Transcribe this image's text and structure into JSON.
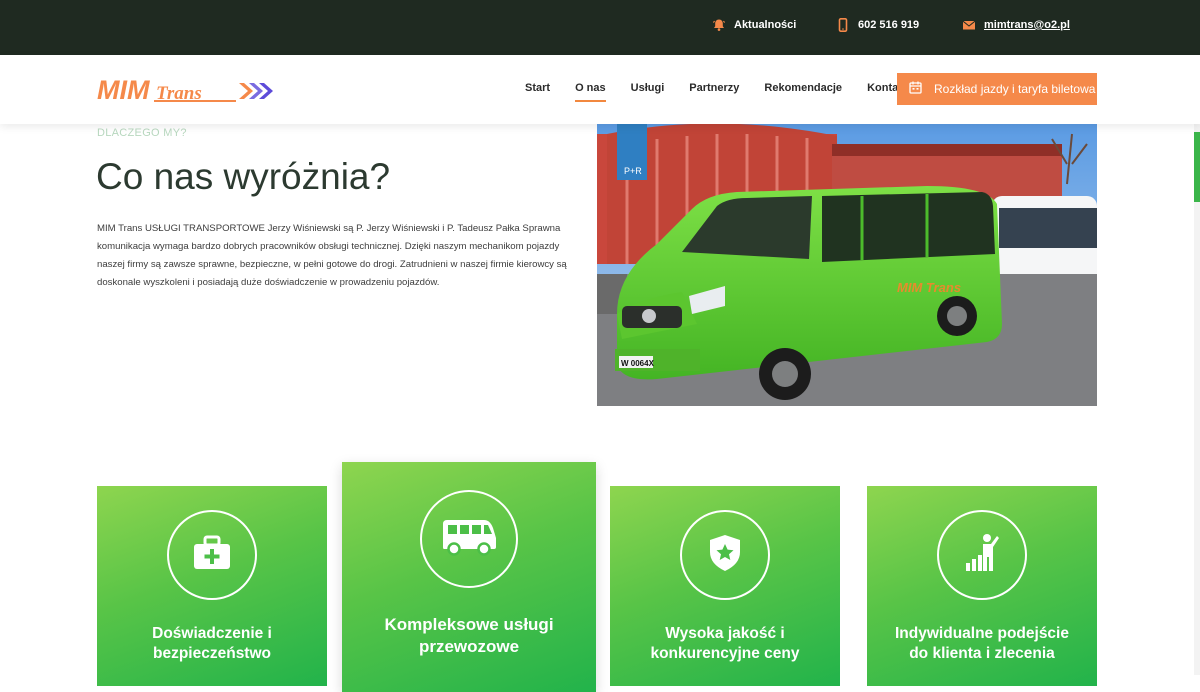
{
  "topbar": {
    "news_label": "Aktualności",
    "phone": "602 516 919",
    "email": "mimtrans@o2.pl"
  },
  "header": {
    "logo_text": "MIM TRANS",
    "nav": [
      {
        "label": "Start",
        "active": false
      },
      {
        "label": "O nas",
        "active": true
      },
      {
        "label": "Usługi",
        "active": false
      },
      {
        "label": "Partnerzy",
        "active": false
      },
      {
        "label": "Rekomendacje",
        "active": false
      },
      {
        "label": "Kontakt",
        "active": false
      }
    ],
    "cta_label": "Rozkład jazdy i taryfa biletowa"
  },
  "main": {
    "eyebrow": "DLACZEGO MY?",
    "title": "Co nas wyróżnia?",
    "paragraph": "MIM Trans USŁUGI TRANSPORTOWE Jerzy Wiśniewski są P. Jerzy Wiśniewski i P. Tadeusz Pałka Sprawna komunikacja wymaga bardzo dobrych pracowników obsługi technicznej. Dzięki naszym mechanikom pojazdy naszej firmy są zawsze sprawne, bezpieczne, w pełni gotowe do drogi. Zatrudnieni w naszej firmie kierowcy są doskonale wyszkoleni i posiadają duże doświadczenie w prowadzeniu pojazdów.",
    "photo_plate": "W 0064X"
  },
  "cards": [
    {
      "line1": "Doświadczenie i",
      "line2": "bezpieczeństwo",
      "icon": "first-aid-kit-icon"
    },
    {
      "line1": "Kompleksowe usługi",
      "line2": "przewozowe",
      "icon": "van-icon"
    },
    {
      "line1": "Wysoka jakość i",
      "line2": "konkurencyjne ceny",
      "icon": "star-shield-icon"
    },
    {
      "line1": "Indywidualne podejście",
      "line2": "do klienta i zlecenia",
      "icon": "person-growth-icon"
    }
  ],
  "colors": {
    "topbar_bg": "#1f2a21",
    "accent_orange": "#f5894a",
    "card_green": "#4cbf48",
    "title_dark": "#2c3a30"
  }
}
